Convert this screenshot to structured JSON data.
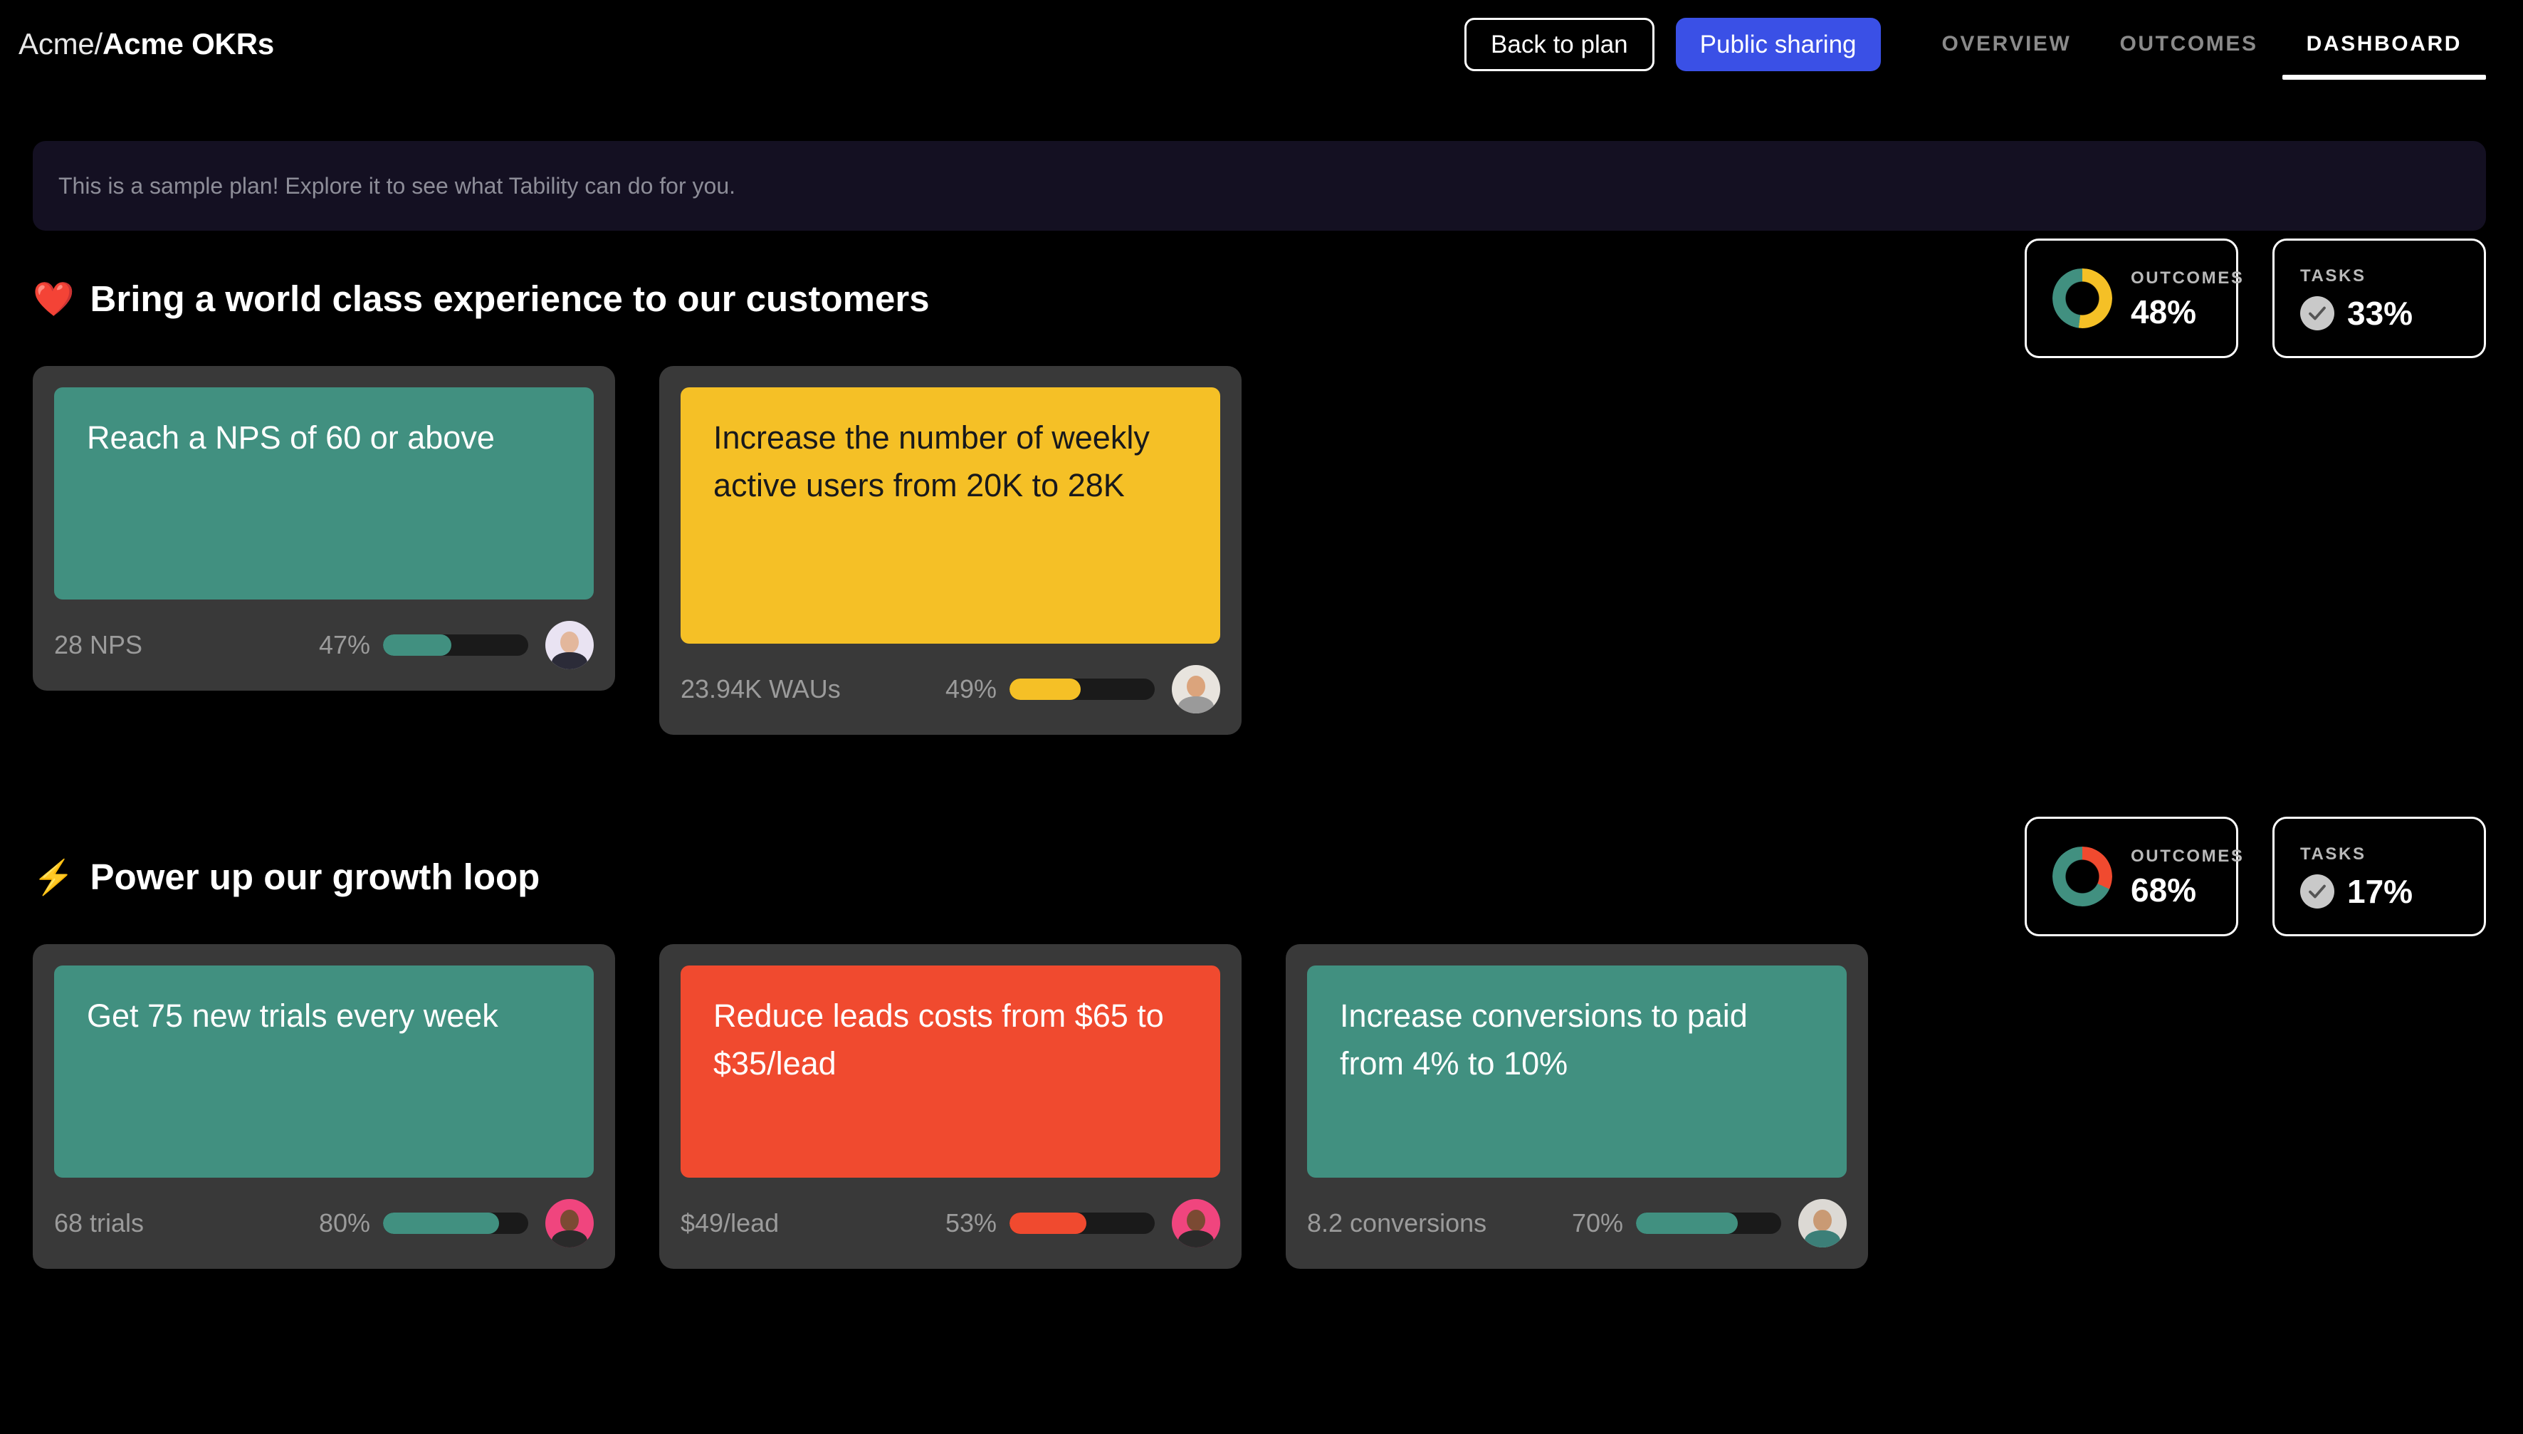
{
  "header": {
    "brand_org": "Acme/",
    "brand_plan": "Acme OKRs",
    "back_button": "Back to plan",
    "share_button": "Public sharing",
    "tabs": [
      {
        "label": "OVERVIEW",
        "active": false
      },
      {
        "label": "OUTCOMES",
        "active": false
      },
      {
        "label": "DASHBOARD",
        "active": true
      }
    ],
    "accent_color": "#3a50e6"
  },
  "banner": {
    "text": "This is a sample plan! Explore it to see what Tability can do for you."
  },
  "colors": {
    "green": "#419080",
    "yellow": "#f5c026",
    "red": "#f04a2f",
    "card_bg": "#393939",
    "track": "#1a1a1a",
    "page_bg": "#000000"
  },
  "sections": [
    {
      "emoji": "❤️",
      "title": "Bring a world class experience to our customers",
      "stats": {
        "outcomes_label": "OUTCOMES",
        "outcomes_value": "48%",
        "outcomes_donut": {
          "green_pct": 48,
          "other_pct": 52,
          "other_color": "#f5c026"
        },
        "tasks_label": "TASKS",
        "tasks_value": "33%"
      },
      "cards": [
        {
          "title": "Reach a NPS of 60 or above",
          "color": "green",
          "lines": 2,
          "metric": "28 NPS",
          "percent": "47%",
          "percent_value": 47,
          "avatar_bg": "#e9e3f2",
          "avatar_face": "#e3b79c",
          "avatar_body": "#2b2b38"
        },
        {
          "title": "Increase the number of weekly active users from 20K to 28K",
          "color": "yellow",
          "lines": 3,
          "metric": "23.94K WAUs",
          "percent": "49%",
          "percent_value": 49,
          "avatar_bg": "#e8e4de",
          "avatar_face": "#dba47c",
          "avatar_body": "#9a9a9a"
        }
      ]
    },
    {
      "emoji": "⚡",
      "title": "Power up our growth loop",
      "stats": {
        "outcomes_label": "OUTCOMES",
        "outcomes_value": "68%",
        "outcomes_donut": {
          "green_pct": 68,
          "other_pct": 32,
          "other_color": "#f04a2f"
        },
        "tasks_label": "TASKS",
        "tasks_value": "17%"
      },
      "cards": [
        {
          "title": "Get 75 new trials every week",
          "color": "green",
          "lines": 2,
          "metric": "68 trials",
          "percent": "80%",
          "percent_value": 80,
          "avatar_bg": "#f0457e",
          "avatar_face": "#7b4a33",
          "avatar_body": "#2a2a2a"
        },
        {
          "title": "Reduce leads costs from $65 to $35/lead",
          "color": "red",
          "lines": 2,
          "metric": "$49/lead",
          "percent": "53%",
          "percent_value": 53,
          "avatar_bg": "#f0457e",
          "avatar_face": "#7b4a33",
          "avatar_body": "#2a2a2a"
        },
        {
          "title": "Increase conversions to paid from 4% to 10%",
          "color": "green",
          "lines": 2,
          "metric": "8.2 conversions",
          "percent": "70%",
          "percent_value": 70,
          "avatar_bg": "#dcd9d4",
          "avatar_face": "#c99a74",
          "avatar_body": "#3c7f78"
        }
      ]
    }
  ]
}
